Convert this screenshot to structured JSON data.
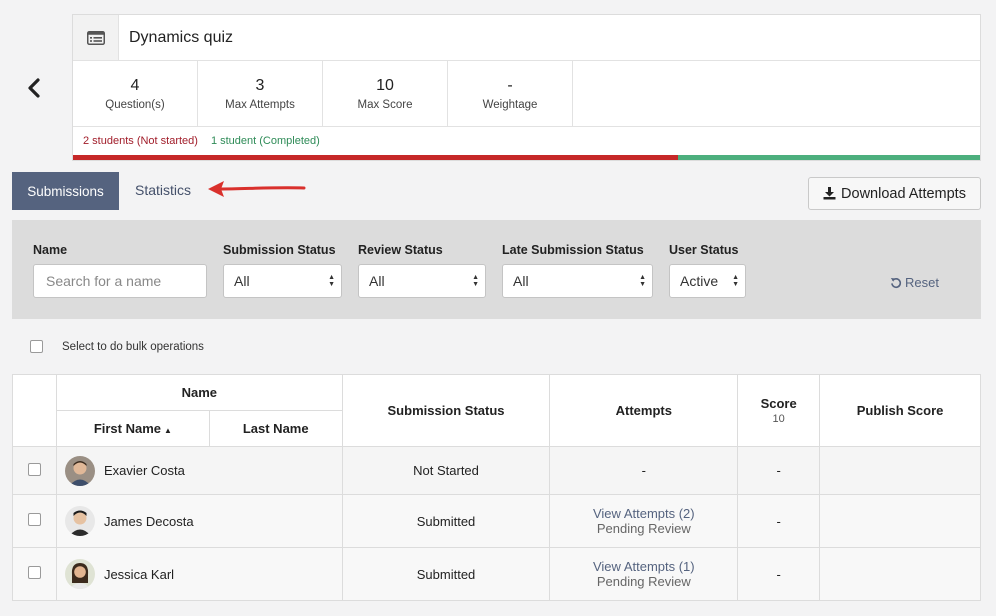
{
  "quiz": {
    "title": "Dynamics quiz",
    "stats": [
      {
        "value": "4",
        "label": "Question(s)"
      },
      {
        "value": "3",
        "label": "Max Attempts"
      },
      {
        "value": "10",
        "label": "Max Score"
      },
      {
        "value": "-",
        "label": "Weightage"
      }
    ],
    "legend": {
      "not_started": "2 students (Not started)",
      "completed": "1 student (Completed)"
    },
    "progress": {
      "not_started_fraction": 0.667,
      "completed_fraction": 0.333
    }
  },
  "tabs": {
    "submissions": "Submissions",
    "statistics": "Statistics"
  },
  "download_label": "Download Attempts",
  "filters": {
    "name_label": "Name",
    "name_placeholder": "Search for a name",
    "submission_status_label": "Submission Status",
    "submission_status_value": "All",
    "review_status_label": "Review Status",
    "review_status_value": "All",
    "late_status_label": "Late Submission Status",
    "late_status_value": "All",
    "user_status_label": "User Status",
    "user_status_value": "Active",
    "reset_label": "Reset"
  },
  "bulk_label": "Select to do bulk operations",
  "table": {
    "headers": {
      "name": "Name",
      "first_name": "First Name",
      "last_name": "Last Name",
      "submission_status": "Submission Status",
      "attempts": "Attempts",
      "score": "Score",
      "score_max": "10",
      "publish_score": "Publish Score"
    },
    "rows": [
      {
        "name": "Exavier Costa",
        "status": "Not Started",
        "attempts": "-",
        "pending": "",
        "score": "-"
      },
      {
        "name": "James Decosta",
        "status": "Submitted",
        "attempts": "View Attempts (2)",
        "pending": "Pending Review",
        "score": "-"
      },
      {
        "name": "Jessica Karl",
        "status": "Submitted",
        "attempts": "View Attempts (1)",
        "pending": "Pending Review",
        "score": "-"
      }
    ]
  },
  "colors": {
    "accent": "#55637f",
    "not_started": "#c62828",
    "completed": "#4caf7d"
  }
}
